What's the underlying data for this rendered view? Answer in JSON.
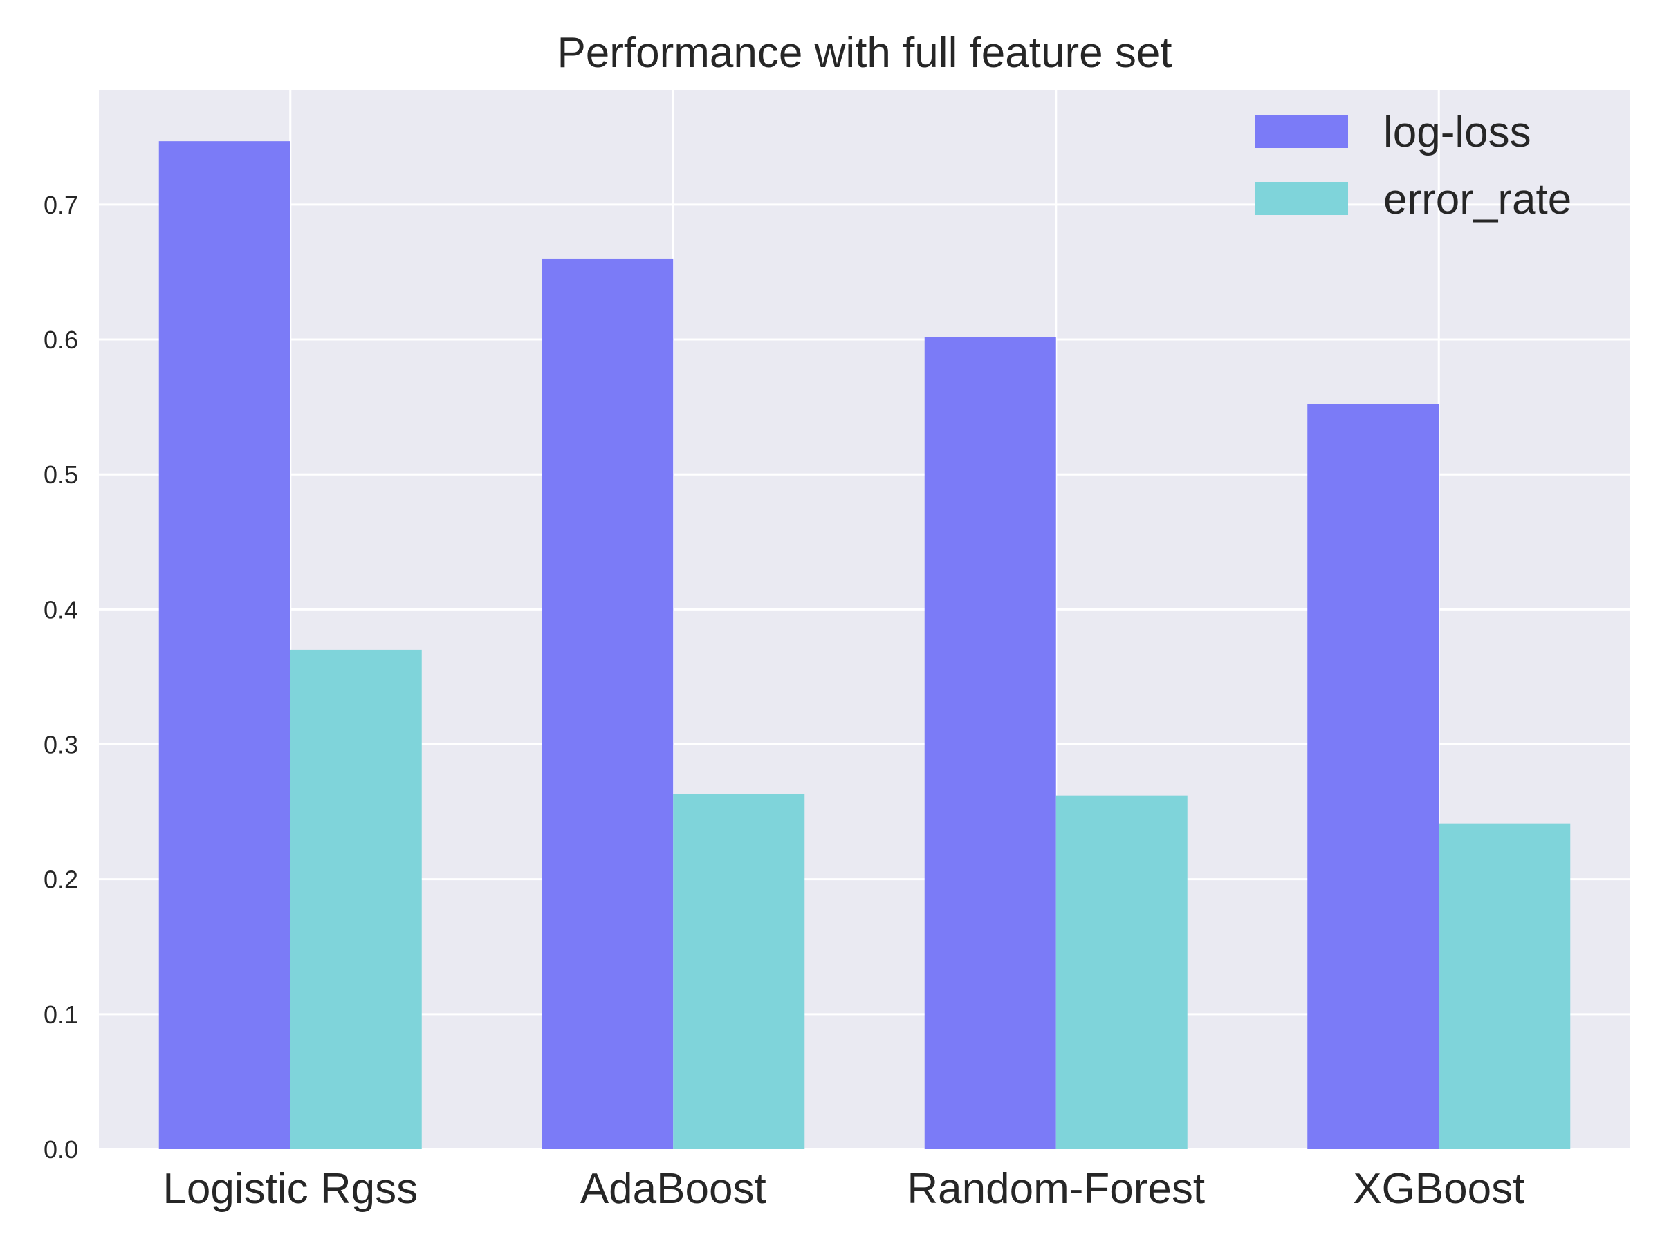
{
  "chart_data": {
    "type": "bar",
    "title": "Performance with full feature set",
    "xlabel": "",
    "ylabel": "",
    "categories": [
      "Logistic Rgss",
      "AdaBoost",
      "Random-Forest",
      "XGBoost"
    ],
    "series": [
      {
        "name": "log-loss",
        "values": [
          0.747,
          0.66,
          0.602,
          0.552
        ],
        "color": "#7b7bf7"
      },
      {
        "name": "error_rate",
        "values": [
          0.37,
          0.263,
          0.262,
          0.241
        ],
        "color": "#7fd4da"
      }
    ],
    "ylim": [
      0.0,
      0.785
    ],
    "yticks": [
      "0.0",
      "0.1",
      "0.2",
      "0.3",
      "0.4",
      "0.5",
      "0.6",
      "0.7"
    ],
    "grid": true,
    "legend_position": "top-right",
    "colors": {
      "plot_background": "#eaeaf2",
      "grid": "#ffffff"
    }
  }
}
